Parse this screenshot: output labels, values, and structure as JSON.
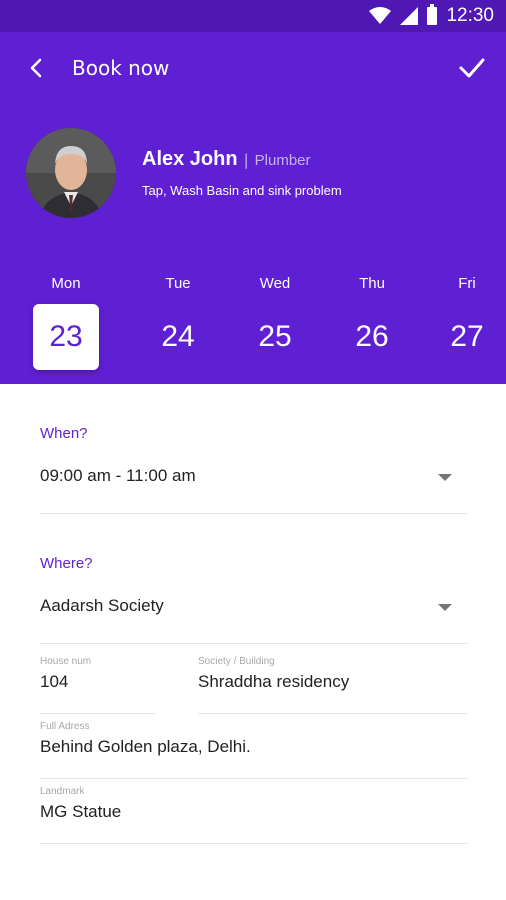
{
  "status_bar": {
    "time": "12:30",
    "icons": [
      "wifi-icon",
      "signal-icon",
      "battery-icon"
    ]
  },
  "appbar": {
    "title": "Book now",
    "back_icon": "chevron-left-icon",
    "confirm_icon": "check-icon"
  },
  "colors": {
    "primary": "#5f1fd3",
    "status_bar": "#4f18b4",
    "accent_text": "#6322d6",
    "role_text": "#c7b2f1"
  },
  "provider": {
    "name": "Alex John",
    "separator": "|",
    "role": "Plumber",
    "description": "Tap, Wash Basin and sink problem"
  },
  "days": [
    {
      "name": "Mon",
      "date": "23",
      "selected": true
    },
    {
      "name": "Tue",
      "date": "24",
      "selected": false
    },
    {
      "name": "Wed",
      "date": "25",
      "selected": false
    },
    {
      "name": "Thu",
      "date": "26",
      "selected": false
    },
    {
      "name": "Fri",
      "date": "27",
      "selected": false
    }
  ],
  "when": {
    "label": "When?",
    "value": "09:00 am - 11:00 am"
  },
  "where": {
    "label": "Where?",
    "area": "Aadarsh Society",
    "fields": {
      "house_num": {
        "label": "House num",
        "value": "104"
      },
      "society": {
        "label": "Society / Building",
        "value": "Shraddha residency"
      },
      "full_address": {
        "label": "Full Adress",
        "value": "Behind Golden plaza, Delhi."
      },
      "landmark": {
        "label": "Landmark",
        "value": "MG Statue"
      }
    }
  }
}
